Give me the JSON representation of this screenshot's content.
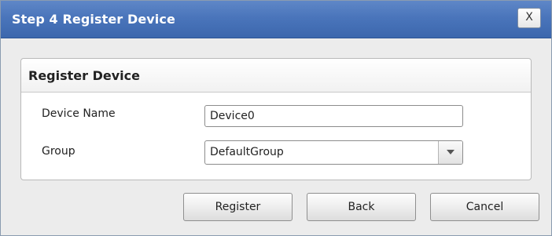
{
  "window": {
    "title": "Step 4 Register Device",
    "close_label": "X"
  },
  "panel": {
    "title": "Register Device",
    "fields": {
      "device_name": {
        "label": "Device Name",
        "value": "Device0"
      },
      "group": {
        "label": "Group",
        "selected": "DefaultGroup",
        "dropdown_icon": "chevron-down-icon"
      }
    }
  },
  "buttons": {
    "register": "Register",
    "back": "Back",
    "cancel": "Cancel"
  },
  "colors": {
    "titlebar": "#4a75bb",
    "background": "#ececec"
  }
}
